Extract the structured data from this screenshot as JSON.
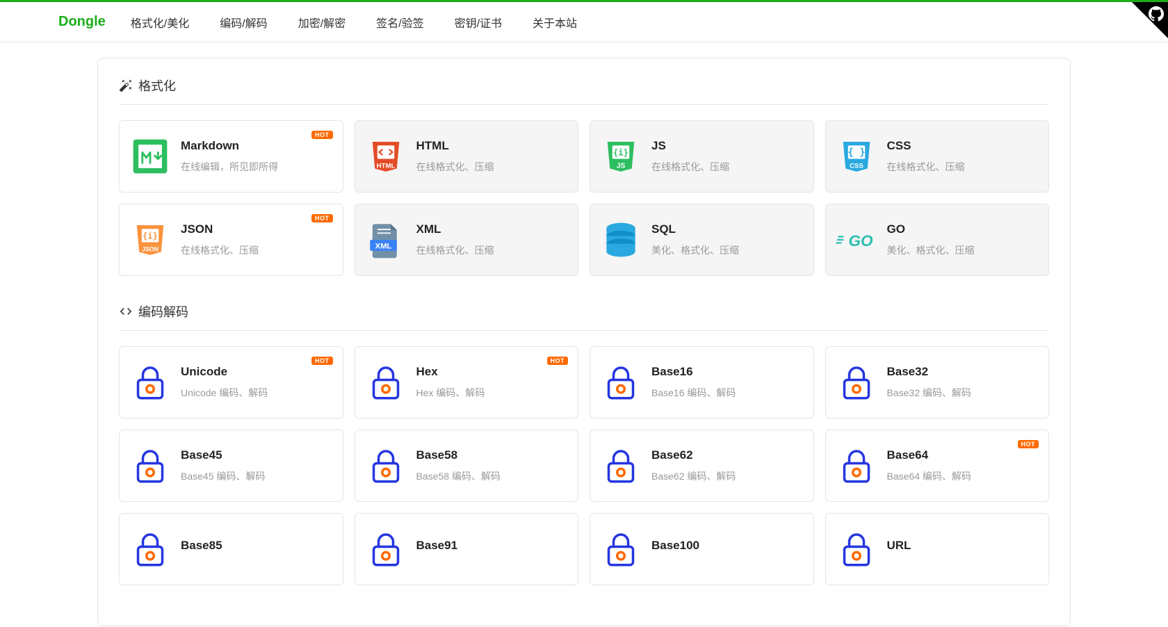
{
  "brand": "Dongle",
  "nav": [
    "格式化/美化",
    "编码/解码",
    "加密/解密",
    "签名/验签",
    "密钥/证书",
    "关于本站"
  ],
  "hot_label": "HOT",
  "sections": [
    {
      "icon": "wand",
      "title": "格式化",
      "cards": [
        {
          "title": "Markdown",
          "desc": "在线编辑，所见即所得",
          "icon": "markdown",
          "hot": true,
          "muted": false
        },
        {
          "title": "HTML",
          "desc": "在线格式化、压缩",
          "icon": "html",
          "hot": false,
          "muted": true
        },
        {
          "title": "JS",
          "desc": "在线格式化、压缩",
          "icon": "js",
          "hot": false,
          "muted": true
        },
        {
          "title": "CSS",
          "desc": "在线格式化、压缩",
          "icon": "css",
          "hot": false,
          "muted": true
        },
        {
          "title": "JSON",
          "desc": "在线格式化、压缩",
          "icon": "json",
          "hot": true,
          "muted": false
        },
        {
          "title": "XML",
          "desc": "在线格式化、压缩",
          "icon": "xml",
          "hot": false,
          "muted": true
        },
        {
          "title": "SQL",
          "desc": "美化、格式化、压缩",
          "icon": "sql",
          "hot": false,
          "muted": true
        },
        {
          "title": "GO",
          "desc": "美化、格式化、压缩",
          "icon": "go",
          "hot": false,
          "muted": true
        }
      ]
    },
    {
      "icon": "code",
      "title": "编码解码",
      "cards": [
        {
          "title": "Unicode",
          "desc": "Unicode 编码、解码",
          "icon": "lock",
          "hot": true,
          "muted": false
        },
        {
          "title": "Hex",
          "desc": "Hex 编码、解码",
          "icon": "lock",
          "hot": true,
          "muted": false
        },
        {
          "title": "Base16",
          "desc": "Base16 编码、解码",
          "icon": "lock",
          "hot": false,
          "muted": false
        },
        {
          "title": "Base32",
          "desc": "Base32 编码、解码",
          "icon": "lock",
          "hot": false,
          "muted": false
        },
        {
          "title": "Base45",
          "desc": "Base45 编码、解码",
          "icon": "lock",
          "hot": false,
          "muted": false
        },
        {
          "title": "Base58",
          "desc": "Base58 编码、解码",
          "icon": "lock",
          "hot": false,
          "muted": false
        },
        {
          "title": "Base62",
          "desc": "Base62 编码、解码",
          "icon": "lock",
          "hot": false,
          "muted": false
        },
        {
          "title": "Base64",
          "desc": "Base64 编码、解码",
          "icon": "lock",
          "hot": true,
          "muted": false
        },
        {
          "title": "Base85",
          "desc": "",
          "icon": "lock",
          "hot": false,
          "muted": false
        },
        {
          "title": "Base91",
          "desc": "",
          "icon": "lock",
          "hot": false,
          "muted": false
        },
        {
          "title": "Base100",
          "desc": "",
          "icon": "lock",
          "hot": false,
          "muted": false
        },
        {
          "title": "URL",
          "desc": "",
          "icon": "lock",
          "hot": false,
          "muted": false
        }
      ]
    }
  ]
}
